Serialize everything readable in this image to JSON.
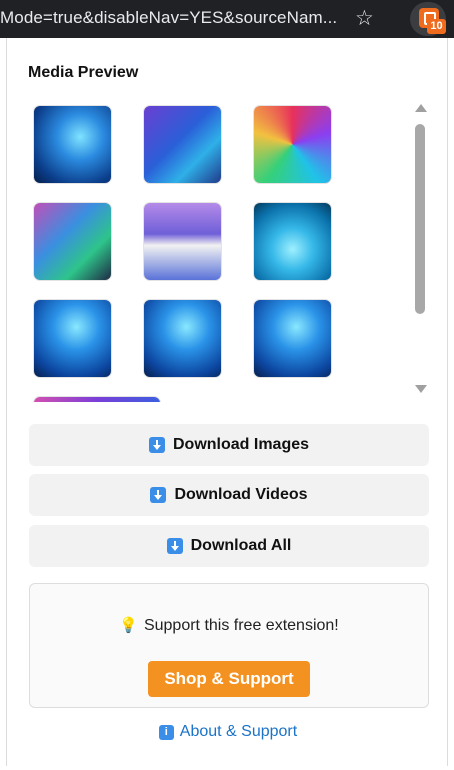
{
  "browser": {
    "url_fragment": "Mode=true&disableNav=YES&sourceNam...",
    "bookmark_icon": "star-icon",
    "extension_icon": "extension-icon",
    "extension_badge": "10",
    "accent": "#ef6c1f"
  },
  "popup": {
    "title": "Media Preview",
    "thumbnails": [
      {
        "icon": "image-thumbnail"
      },
      {
        "icon": "image-thumbnail"
      },
      {
        "icon": "image-thumbnail"
      },
      {
        "icon": "image-thumbnail"
      },
      {
        "icon": "image-thumbnail"
      },
      {
        "icon": "image-thumbnail"
      },
      {
        "icon": "image-thumbnail"
      },
      {
        "icon": "image-thumbnail"
      },
      {
        "icon": "image-thumbnail"
      },
      {
        "icon": "image-thumbnail"
      }
    ],
    "buttons": {
      "download_images": "Download Images",
      "download_videos": "Download Videos",
      "download_all": "Download All"
    },
    "support": {
      "text": "Support this free extension!",
      "shop_button": "Shop & Support",
      "shop_color": "#f39221"
    },
    "about_link": "About & Support",
    "link_color": "#1a73c8"
  }
}
